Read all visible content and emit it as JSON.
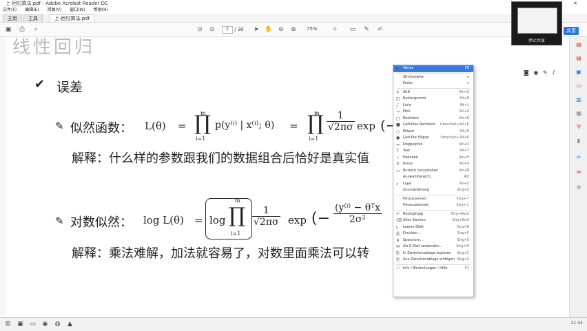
{
  "window": {
    "title": "上-回归算法.pdf - Adobe Acrobat Reader DC",
    "minimize": "—",
    "maximize": "□",
    "close": "✕"
  },
  "menu": [
    "文件(F)",
    "编辑(E)",
    "视图(V)",
    "窗口(W)",
    "帮助(H)"
  ],
  "tabs": {
    "home": "主页",
    "tools": "工具",
    "document": "上-回归算法.pdf"
  },
  "toolbar": {
    "page_current": "7",
    "page_total": "/ 30",
    "zoom": "75%",
    "share": "共享"
  },
  "video_overlay": {
    "label": "停止共享"
  },
  "document": {
    "heading_cut": "线性回归",
    "section_check": "✔",
    "section_title": "误差",
    "likelihood": {
      "label": "似然函数：",
      "lhs": "L(θ)",
      "eq1": "=",
      "prod_top": "m",
      "prod_bottom": "i=1",
      "prod_sym": "∏",
      "term": "p(y⁽ⁱ⁾ | x⁽ⁱ⁾; θ)",
      "eq2": "=",
      "frac_num": "1",
      "frac_den": "√2πσ",
      "exp": "exp",
      "tail": "(−",
      "explain": "解释：什么样的参数跟我们的数据组合后恰好是真实值"
    },
    "loglikelihood": {
      "label": "对数似然：",
      "lhs": "log L(θ)",
      "eq": "=",
      "log": "log",
      "prod_sym": "∏",
      "prod_top": "m",
      "prod_bottom": "i=1",
      "frac_num": "1",
      "frac_den": "√2πσ",
      "exp": "exp",
      "tail_num": "(y⁽ⁱ⁾ − θᵀx",
      "tail_den": "2σ²",
      "open": "(−",
      "explain": "解释：乘法难解，加法就容易了，对数里面乘法可以转"
    }
  },
  "context_menu": [
    {
      "label": "Werkz",
      "shortcut": "F8",
      "highlight": true,
      "icon": "▸"
    },
    {
      "sep": true
    },
    {
      "label": "Strichstärke",
      "shortcut": "▸",
      "icon": ""
    },
    {
      "label": "Farbe",
      "shortcut": "▸",
      "icon": ""
    },
    {
      "sep": true
    },
    {
      "label": "Stift",
      "shortcut": "Alt+G",
      "icon": "✎"
    },
    {
      "label": "Radiergummi",
      "shortcut": "Alt+E",
      "icon": "◫"
    },
    {
      "label": "Linie",
      "shortcut": "Alt+L",
      "icon": "╱"
    },
    {
      "label": "Pfeil",
      "shortcut": "Alt+A",
      "icon": "→"
    },
    {
      "label": "Rechteck",
      "shortcut": "Alt+R",
      "icon": "□"
    },
    {
      "label": "Gefülltes Rechteck",
      "shortcut": "Umschalt+Alt+R",
      "icon": "■"
    },
    {
      "label": "Ellipse",
      "shortcut": "Alt+E",
      "icon": "○"
    },
    {
      "label": "Gefüllte Ellipse",
      "shortcut": "Umschalt+Alt+E",
      "icon": "●"
    },
    {
      "label": "Doppelpfeil",
      "shortcut": "Alt+D",
      "icon": "↔"
    },
    {
      "label": "Text",
      "shortcut": "Alt+T",
      "icon": "T"
    },
    {
      "label": "Häkchen",
      "shortcut": "Alt+H",
      "icon": "✓"
    },
    {
      "label": "Kreuz",
      "shortcut": "Alt+X",
      "icon": "✗"
    },
    {
      "label": "Bereich zurücklehen",
      "shortcut": "Alt+B",
      "icon": "▭"
    },
    {
      "label": "Auswahlbereich...",
      "shortcut": "#Z",
      "icon": ""
    },
    {
      "label": "Lupe",
      "shortcut": "Alt+Z",
      "icon": "⌕"
    },
    {
      "label": "Zoomanleitung",
      "shortcut": "Strg+Z",
      "icon": ""
    },
    {
      "sep": true
    },
    {
      "label": "Hinzuzoomen",
      "shortcut": "Strg+↑",
      "icon": ""
    },
    {
      "label": "Herauszoomen",
      "shortcut": "Strg+↓",
      "icon": ""
    },
    {
      "sep": true
    },
    {
      "label": "Rückgängig",
      "shortcut": "Strg+Rück",
      "icon": "↶"
    },
    {
      "label": "Alles löschen",
      "shortcut": "Strg+Entf",
      "icon": "⌫"
    },
    {
      "label": "Leeres Blatt",
      "shortcut": "Strg+N",
      "icon": "▯"
    },
    {
      "label": "Drucken...",
      "shortcut": "Strg+P",
      "icon": "⎙"
    },
    {
      "label": "Speichern...",
      "shortcut": "Strg+S",
      "icon": "⬇"
    },
    {
      "label": "Als E-Mail versenden...",
      "shortcut": "Strg+M",
      "icon": "✉"
    },
    {
      "label": "In Zwischenablage kopieren",
      "shortcut": "Strg+C",
      "icon": "⎘"
    },
    {
      "label": "Aus Zwischenablage einfügen",
      "shortcut": "Strg+V",
      "icon": "⎗"
    },
    {
      "sep": true
    },
    {
      "label": "Info / Einstellungen / Hilfe",
      "shortcut": "F1",
      "icon": "ⓘ"
    }
  ],
  "taskbar": {
    "clock": "21:44"
  }
}
